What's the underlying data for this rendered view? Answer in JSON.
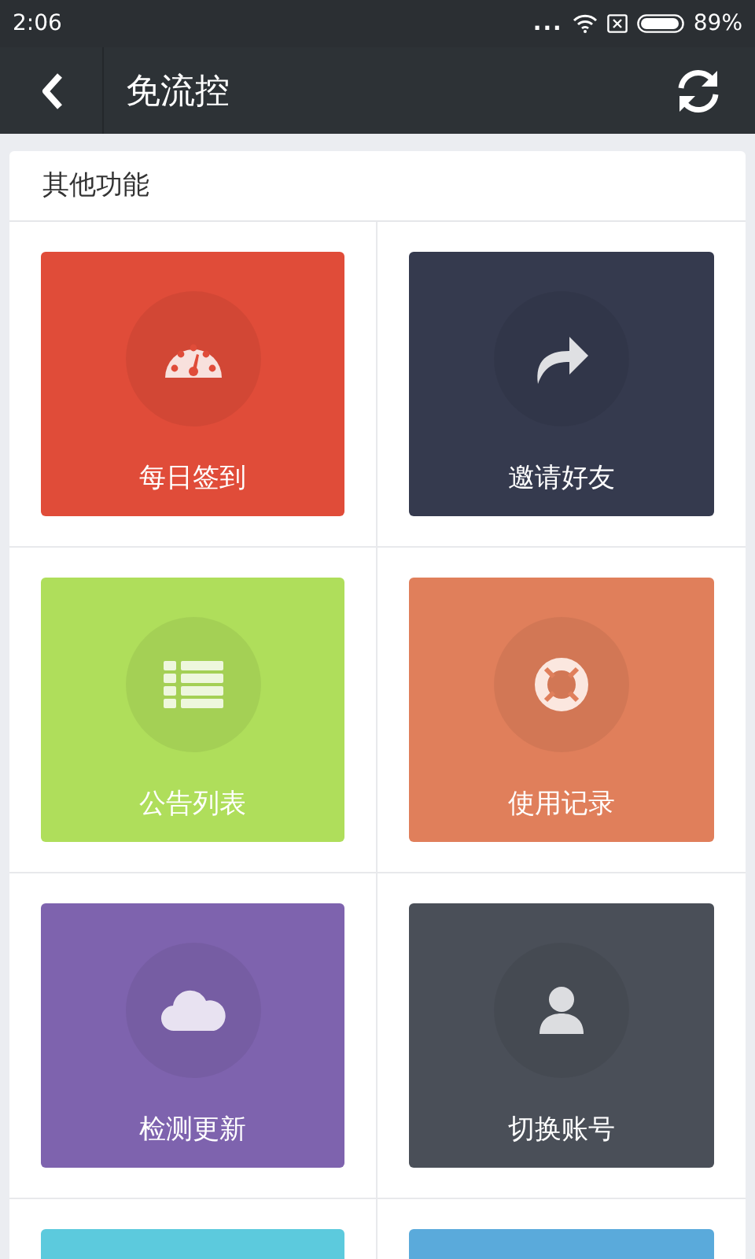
{
  "status_bar": {
    "time": "2:06",
    "dots": "...",
    "battery_text": "89%"
  },
  "header": {
    "title": "免流控"
  },
  "section": {
    "title": "其他功能"
  },
  "tiles": [
    {
      "label": "每日签到",
      "color": "#e04c39"
    },
    {
      "label": "邀请好友",
      "color": "#353a4e"
    },
    {
      "label": "公告列表",
      "color": "#afde5b"
    },
    {
      "label": "使用记录",
      "color": "#e07f5b"
    },
    {
      "label": "检测更新",
      "color": "#7e63ae"
    },
    {
      "label": "切换账号",
      "color": "#4a4f58"
    },
    {
      "color": "#5ccadd"
    },
    {
      "color": "#5aaadb"
    }
  ]
}
